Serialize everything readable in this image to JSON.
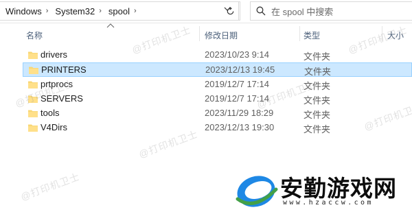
{
  "breadcrumb": [
    "Windows",
    "System32",
    "spool"
  ],
  "search": {
    "placeholder": "在 spool 中搜索"
  },
  "columns": {
    "name": "名称",
    "modified": "修改日期",
    "type": "类型",
    "size": "大小"
  },
  "files": [
    {
      "name": "drivers",
      "date": "2023/10/23 9:14",
      "type": "文件夹"
    },
    {
      "name": "PRINTERS",
      "date": "2023/12/13 19:45",
      "type": "文件夹"
    },
    {
      "name": "prtprocs",
      "date": "2019/12/7 17:14",
      "type": "文件夹"
    },
    {
      "name": "SERVERS",
      "date": "2019/12/7 17:14",
      "type": "文件夹"
    },
    {
      "name": "tools",
      "date": "2023/11/29 18:29",
      "type": "文件夹"
    },
    {
      "name": "V4Dirs",
      "date": "2023/12/13 19:30",
      "type": "文件夹"
    }
  ],
  "selected_index": 1,
  "watermark": "@打印机卫士",
  "logo": {
    "title": "安勤游戏网",
    "url": "www.hzaccw.com"
  },
  "colors": {
    "selection_bg": "#cce8ff",
    "selection_border": "#99d1ff",
    "folder": "#f8d775",
    "logo_blue": "#1e88e5"
  },
  "icons": {
    "folder": "folder-icon",
    "refresh": "refresh-icon",
    "search": "search-icon",
    "chevron": "chevron-right-icon"
  }
}
